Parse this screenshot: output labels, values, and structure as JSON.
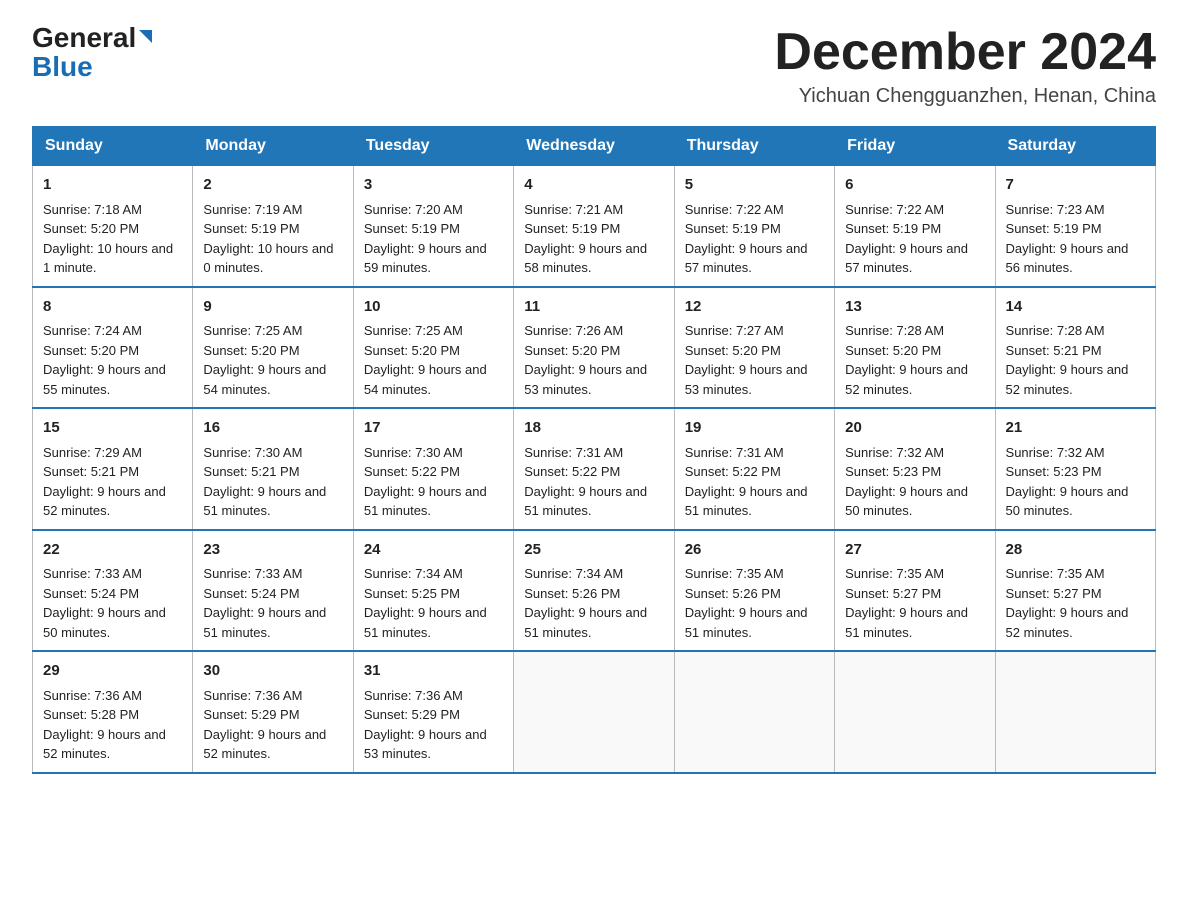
{
  "header": {
    "logo_line1": "General",
    "logo_line2": "Blue",
    "month": "December 2024",
    "location": "Yichuan Chengguanzhen, Henan, China"
  },
  "weekdays": [
    "Sunday",
    "Monday",
    "Tuesday",
    "Wednesday",
    "Thursday",
    "Friday",
    "Saturday"
  ],
  "weeks": [
    [
      {
        "day": "1",
        "sunrise": "7:18 AM",
        "sunset": "5:20 PM",
        "daylight": "10 hours and 1 minute."
      },
      {
        "day": "2",
        "sunrise": "7:19 AM",
        "sunset": "5:19 PM",
        "daylight": "10 hours and 0 minutes."
      },
      {
        "day": "3",
        "sunrise": "7:20 AM",
        "sunset": "5:19 PM",
        "daylight": "9 hours and 59 minutes."
      },
      {
        "day": "4",
        "sunrise": "7:21 AM",
        "sunset": "5:19 PM",
        "daylight": "9 hours and 58 minutes."
      },
      {
        "day": "5",
        "sunrise": "7:22 AM",
        "sunset": "5:19 PM",
        "daylight": "9 hours and 57 minutes."
      },
      {
        "day": "6",
        "sunrise": "7:22 AM",
        "sunset": "5:19 PM",
        "daylight": "9 hours and 57 minutes."
      },
      {
        "day": "7",
        "sunrise": "7:23 AM",
        "sunset": "5:19 PM",
        "daylight": "9 hours and 56 minutes."
      }
    ],
    [
      {
        "day": "8",
        "sunrise": "7:24 AM",
        "sunset": "5:20 PM",
        "daylight": "9 hours and 55 minutes."
      },
      {
        "day": "9",
        "sunrise": "7:25 AM",
        "sunset": "5:20 PM",
        "daylight": "9 hours and 54 minutes."
      },
      {
        "day": "10",
        "sunrise": "7:25 AM",
        "sunset": "5:20 PM",
        "daylight": "9 hours and 54 minutes."
      },
      {
        "day": "11",
        "sunrise": "7:26 AM",
        "sunset": "5:20 PM",
        "daylight": "9 hours and 53 minutes."
      },
      {
        "day": "12",
        "sunrise": "7:27 AM",
        "sunset": "5:20 PM",
        "daylight": "9 hours and 53 minutes."
      },
      {
        "day": "13",
        "sunrise": "7:28 AM",
        "sunset": "5:20 PM",
        "daylight": "9 hours and 52 minutes."
      },
      {
        "day": "14",
        "sunrise": "7:28 AM",
        "sunset": "5:21 PM",
        "daylight": "9 hours and 52 minutes."
      }
    ],
    [
      {
        "day": "15",
        "sunrise": "7:29 AM",
        "sunset": "5:21 PM",
        "daylight": "9 hours and 52 minutes."
      },
      {
        "day": "16",
        "sunrise": "7:30 AM",
        "sunset": "5:21 PM",
        "daylight": "9 hours and 51 minutes."
      },
      {
        "day": "17",
        "sunrise": "7:30 AM",
        "sunset": "5:22 PM",
        "daylight": "9 hours and 51 minutes."
      },
      {
        "day": "18",
        "sunrise": "7:31 AM",
        "sunset": "5:22 PM",
        "daylight": "9 hours and 51 minutes."
      },
      {
        "day": "19",
        "sunrise": "7:31 AM",
        "sunset": "5:22 PM",
        "daylight": "9 hours and 51 minutes."
      },
      {
        "day": "20",
        "sunrise": "7:32 AM",
        "sunset": "5:23 PM",
        "daylight": "9 hours and 50 minutes."
      },
      {
        "day": "21",
        "sunrise": "7:32 AM",
        "sunset": "5:23 PM",
        "daylight": "9 hours and 50 minutes."
      }
    ],
    [
      {
        "day": "22",
        "sunrise": "7:33 AM",
        "sunset": "5:24 PM",
        "daylight": "9 hours and 50 minutes."
      },
      {
        "day": "23",
        "sunrise": "7:33 AM",
        "sunset": "5:24 PM",
        "daylight": "9 hours and 51 minutes."
      },
      {
        "day": "24",
        "sunrise": "7:34 AM",
        "sunset": "5:25 PM",
        "daylight": "9 hours and 51 minutes."
      },
      {
        "day": "25",
        "sunrise": "7:34 AM",
        "sunset": "5:26 PM",
        "daylight": "9 hours and 51 minutes."
      },
      {
        "day": "26",
        "sunrise": "7:35 AM",
        "sunset": "5:26 PM",
        "daylight": "9 hours and 51 minutes."
      },
      {
        "day": "27",
        "sunrise": "7:35 AM",
        "sunset": "5:27 PM",
        "daylight": "9 hours and 51 minutes."
      },
      {
        "day": "28",
        "sunrise": "7:35 AM",
        "sunset": "5:27 PM",
        "daylight": "9 hours and 52 minutes."
      }
    ],
    [
      {
        "day": "29",
        "sunrise": "7:36 AM",
        "sunset": "5:28 PM",
        "daylight": "9 hours and 52 minutes."
      },
      {
        "day": "30",
        "sunrise": "7:36 AM",
        "sunset": "5:29 PM",
        "daylight": "9 hours and 52 minutes."
      },
      {
        "day": "31",
        "sunrise": "7:36 AM",
        "sunset": "5:29 PM",
        "daylight": "9 hours and 53 minutes."
      },
      null,
      null,
      null,
      null
    ]
  ]
}
